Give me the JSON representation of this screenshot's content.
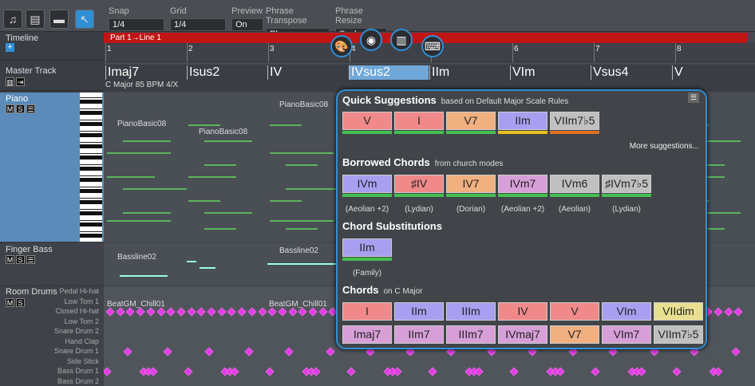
{
  "toolbar": {
    "snap": {
      "label": "Snap",
      "value": "1/4"
    },
    "grid": {
      "label": "Grid",
      "value": "1/4"
    },
    "preview": {
      "label": "Preview",
      "value": "On"
    },
    "phrase_transpose": {
      "label": "Phrase Transpose",
      "value": "Phrase"
    },
    "phrase_resize": {
      "label": "Phrase Resize",
      "value": "Scale"
    }
  },
  "tracks": {
    "timeline": "Timeline",
    "master": "Master Track",
    "piano": "Piano",
    "finger_bass": "Finger Bass",
    "room_drums": "Room Drums"
  },
  "drum_lanes": [
    "Pedal Hi-hat",
    "Low Tom 1",
    "Closed Hi-hat",
    "Low Tom 2",
    "Snare Drum 2",
    "Hand Clap",
    "Snare Drum 1",
    "Side Stick",
    "Bass Drum 1",
    "Bass Drum 2"
  ],
  "part": "Part 1→Line 1",
  "ruler": [
    "1",
    "2",
    "3",
    "4",
    "5",
    "6",
    "7",
    "8"
  ],
  "chords": [
    "Imaj7",
    "Isus2",
    "IV",
    "IVsus2",
    "IIm",
    "VIm",
    "Vsus4",
    "V"
  ],
  "key_info": "C Major  85 BPM  4/X",
  "clips": {
    "piano1": "PianoBasic08",
    "piano2": "PianoBasic08",
    "piano3": "PianoBasic08",
    "piano4": "PianoBasic08",
    "piano5": "PianoBasic08",
    "bass1": "Bassline02",
    "bass2": "Bassline02",
    "bass3": "Bassline02",
    "drums1": "BeatGM_Chill01",
    "drums2": "BeatGM_Chill01"
  },
  "popup": {
    "quick": {
      "title": "Quick Suggestions",
      "sub": "based on  Default Major Scale Rules",
      "more": "More suggestions...",
      "chords": [
        "V",
        "I",
        "V7",
        "IIm",
        "VIIm7♭5"
      ]
    },
    "borrowed": {
      "title": "Borrowed Chords",
      "sub": "from  church modes",
      "chords": [
        "IVm",
        "♯IV",
        "IV7",
        "IVm7",
        "IVm6",
        "♯IVm7♭5"
      ],
      "modes": [
        "(Aeolian +2)",
        "(Lydian)",
        "(Dorian)",
        "(Aeolian +2)",
        "(Aeolian)",
        "(Lydian)"
      ]
    },
    "subst": {
      "title": "Chord Substitutions",
      "chords": [
        "IIm"
      ],
      "modes": [
        "(Family)"
      ]
    },
    "chords": {
      "title": "Chords",
      "sub": "on  C Major",
      "row1": [
        "I",
        "IIm",
        "IIIm",
        "IV",
        "V",
        "VIm",
        "VIIdim"
      ],
      "row2": [
        "Imaj7",
        "IIm7",
        "IIIm7",
        "IVmaj7",
        "V7",
        "VIm7",
        "VIIm7♭5"
      ]
    }
  }
}
